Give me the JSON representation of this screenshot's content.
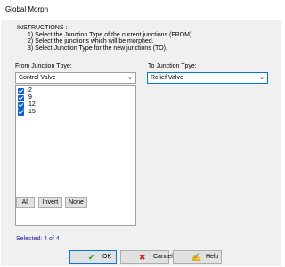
{
  "window": {
    "title": "Global Morph"
  },
  "instructions": {
    "heading": "INSTRUCTIONS :",
    "steps": [
      "1) Select the Junction Type of the current junctions (FROM).",
      "2) Select the junctions which will be morphed.",
      "3) Select Junction Type for the new junctions (TO)."
    ]
  },
  "from": {
    "label": "From Junction Tpye:",
    "value": "Control Valve"
  },
  "to": {
    "label": "To Junction Tpye:",
    "value": "Relief Valve"
  },
  "junctions": [
    {
      "label": "2",
      "checked": true
    },
    {
      "label": "9",
      "checked": true
    },
    {
      "label": "12",
      "checked": true
    },
    {
      "label": "15",
      "checked": true
    }
  ],
  "selection_buttons": {
    "all": "All",
    "invert": "Invert",
    "none": "None"
  },
  "status": {
    "selected_text": "Selected: 4 of 4"
  },
  "footer": {
    "ok": {
      "label": "OK",
      "icon": "ok-check-icon"
    },
    "cancel": {
      "label": "Cancel",
      "icon": "cancel-x-icon"
    },
    "help": {
      "label": "Help",
      "icon": "help-icon"
    }
  },
  "colors": {
    "accent": "#0078d7",
    "checkbox": "#0a5fd0",
    "status_text": "#1a1aa6",
    "cancel_icon": "#d32020",
    "ok_icon": "#1f9d2e"
  }
}
